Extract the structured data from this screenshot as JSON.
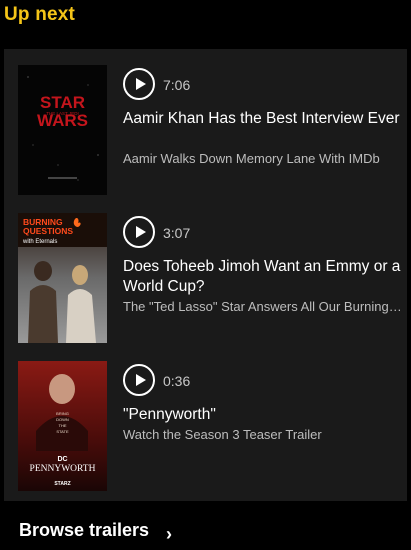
{
  "heading": "Up next",
  "items": [
    {
      "duration": "7:06",
      "title": "Aamir Khan Has the Best Interview Ever",
      "subtitle": "Aamir Walks Down Memory Lane With IMDb",
      "poster": {
        "icon": "star-wars-poster",
        "title_top": "STAR",
        "title_bottom": "WARS",
        "tagline": "THE LAST JEDI"
      }
    },
    {
      "duration": "3:07",
      "title": "Does Toheeb Jimoh Want an Emmy or a World Cup?",
      "subtitle": "The \"Ted Lasso\" Star Answers All Our Burning Questions",
      "poster": {
        "icon": "burning-questions-poster",
        "line1": "BURNING",
        "line2": "QUESTIONS",
        "line3": "with Eternals"
      }
    },
    {
      "duration": "0:36",
      "title": "\"Pennyworth\"",
      "subtitle": "Watch the Season 3 Teaser Trailer",
      "poster": {
        "icon": "pennyworth-poster",
        "line1": "BRING",
        "line2": "DOWN",
        "line3": "THE",
        "line4": "STATE",
        "brand": "DC",
        "name": "PENNYWORTH",
        "network": "STARZ"
      }
    }
  ],
  "browse_label": "Browse trailers",
  "browse_icon": "chevron-right-icon",
  "colors": {
    "accent": "#f5c518",
    "panel": "#1a1a1a",
    "background": "#000000"
  }
}
